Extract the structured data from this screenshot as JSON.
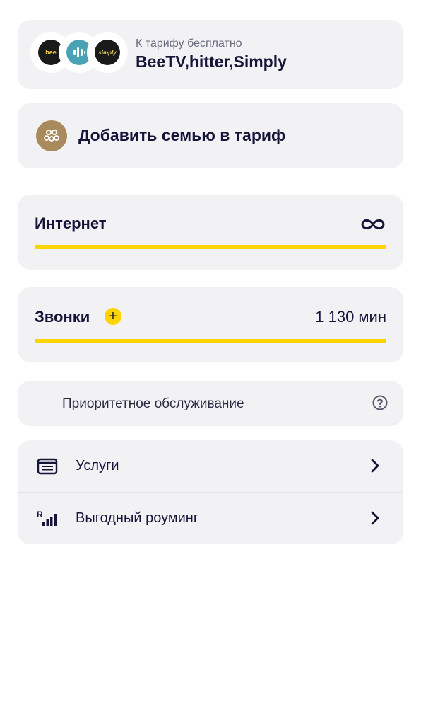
{
  "free_services_card": {
    "caption": "К тарифу бесплатно",
    "services": "BeeTV,hitter,Simply",
    "logos": [
      {
        "name": "beetv-logo",
        "text": "bee"
      },
      {
        "name": "hitter-logo",
        "text": ""
      },
      {
        "name": "simply-logo",
        "text": "simply"
      }
    ]
  },
  "family_card": {
    "label": "Добавить семью в тариф",
    "icon": "family-icon",
    "icon_color": "#a88a5c"
  },
  "internet_card": {
    "title": "Интернет",
    "icon": "infinity-icon",
    "progress": 1.0
  },
  "calls_card": {
    "title": "Звонки",
    "value": "1 130 мин",
    "icon": "plus-icon",
    "progress": 1.0
  },
  "priority_card": {
    "label": "Приоритетное обслуживание",
    "icon": "help-icon"
  },
  "list": {
    "items": [
      {
        "label": "Услуги",
        "icon": "services-icon"
      },
      {
        "label": "Выгодный роуминг",
        "icon": "roaming-icon"
      }
    ]
  },
  "colors": {
    "accent": "#ffd400",
    "card_bg": "#f2f2f5",
    "text": "#15153a"
  }
}
